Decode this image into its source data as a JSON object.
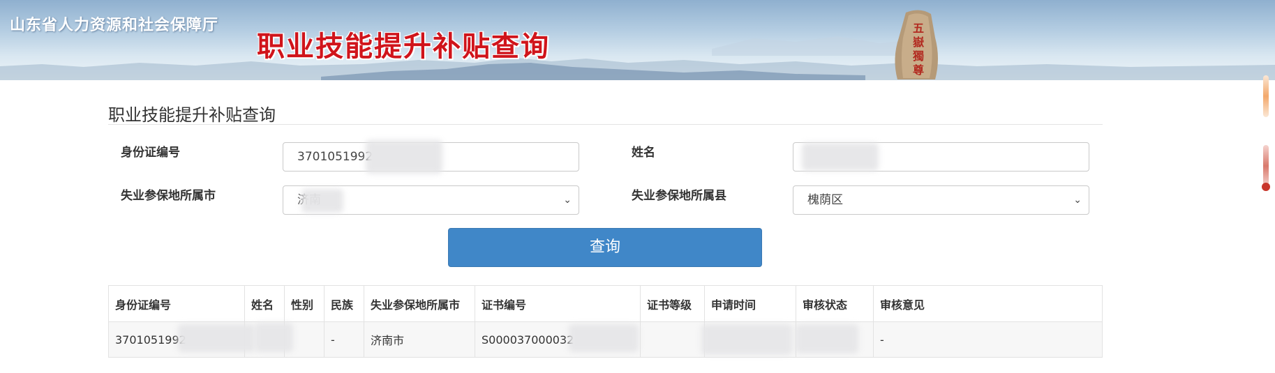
{
  "header": {
    "org_name": "山东省人力资源和社会保障厅",
    "banner_title": "职业技能提升补贴查询",
    "stone_text": "五嶽獨尊"
  },
  "page": {
    "title": "职业技能提升补贴查询"
  },
  "form": {
    "id_label": "身份证编号",
    "id_value": "3701051992",
    "name_label": "姓名",
    "name_value": "",
    "city_label": "失业参保地所属市",
    "city_value": "济南",
    "county_label": "失业参保地所属县",
    "county_value": "槐荫区",
    "submit_label": "查询"
  },
  "table": {
    "headers": [
      "身份证编号",
      "姓名",
      "性别",
      "民族",
      "失业参保地所属市",
      "证书编号",
      "证书等级",
      "申请时间",
      "审核状态",
      "审核意见"
    ],
    "rows": [
      [
        "3701051992",
        "",
        "",
        "-",
        "济南市",
        "S000037000032",
        "",
        "",
        "",
        "-"
      ]
    ]
  },
  "colors": {
    "button": "#4087c8",
    "banner_title": "#d0141b",
    "scroll_accent": "#f3a86b"
  },
  "icons": {
    "select_arrow": "chevron-down-icon"
  }
}
